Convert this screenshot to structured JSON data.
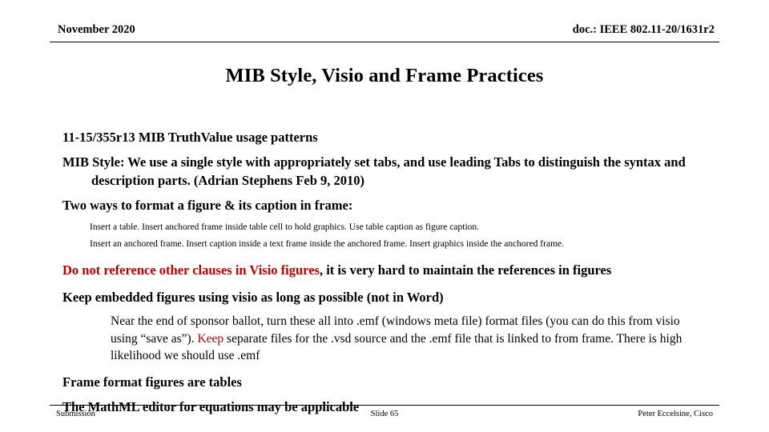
{
  "header": {
    "date": "November 2020",
    "doc_id": "doc.: IEEE 802.11-20/1631r2"
  },
  "title": "MIB Style, Visio and Frame Practices",
  "accent_color": "#c00000",
  "body": {
    "line_reference": "11-15/355r13 MIB TruthValue usage patterns",
    "line_mib_style": "MIB Style: We use a single style with appropriately set tabs,  and use leading Tabs to distinguish the syntax and description parts. (Adrian Stephens Feb 9, 2010)",
    "line_two_ways": "Two ways to format a figure & its caption in frame:",
    "sub_way_1": "Insert a table.  Insert anchored frame inside table cell to hold graphics.  Use table caption as figure caption.",
    "sub_way_2": "Insert an anchored frame.  Insert caption inside a text frame inside the anchored frame.  Insert graphics inside the anchored frame.",
    "line_do_not_red": "Do not reference other clauses in Visio figures",
    "line_do_not_rest": ", it is very hard to maintain the references in figures",
    "line_keep_embedded": "Keep embedded figures using visio as long as possible (not in Word)",
    "para_emf_part1": "Near the end of sponsor ballot, turn these all into .emf (windows meta file) format files (you can do this from visio using “save as”).  ",
    "para_emf_keep": "Keep",
    "para_emf_part2": " separate files for the .vsd source and the .emf file that is linked to from frame. There is high likelihood we should use .emf",
    "line_frame_format": "Frame format figures are tables",
    "line_mathml": "The MathML editor for equations may be applicable"
  },
  "footer": {
    "left": "Submission",
    "center": "Slide 65",
    "right": "Peter Eccelsine, Cisco"
  }
}
